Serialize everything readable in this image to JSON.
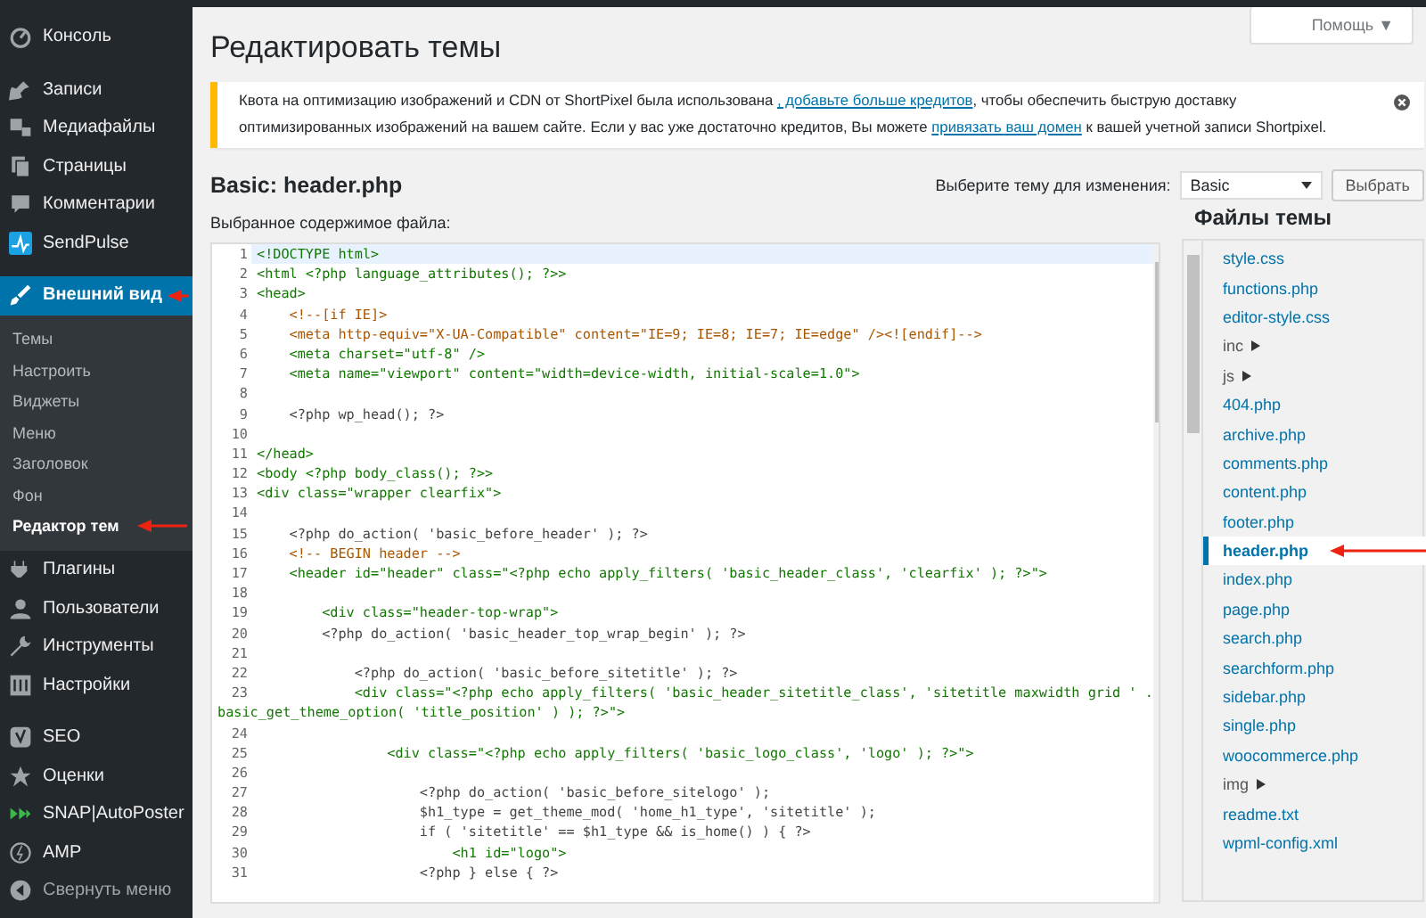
{
  "sidebar": {
    "items": [
      {
        "label": "Консоль",
        "selected": false,
        "marked": false
      },
      {
        "label": "Записи",
        "selected": false,
        "marked": false
      },
      {
        "label": "Медиафайлы",
        "selected": false,
        "marked": false
      },
      {
        "label": "Страницы",
        "selected": false,
        "marked": false
      },
      {
        "label": "Комментарии",
        "selected": false,
        "marked": false
      },
      {
        "label": "SendPulse",
        "selected": false,
        "marked": false
      },
      {
        "label": "Внешний вид",
        "selected": true,
        "marked": true,
        "children": [
          {
            "label": "Темы",
            "selected": false,
            "marked": false
          },
          {
            "label": "Настроить",
            "selected": false,
            "marked": false
          },
          {
            "label": "Виджеты",
            "selected": false,
            "marked": false
          },
          {
            "label": "Меню",
            "selected": false,
            "marked": false
          },
          {
            "label": "Заголовок",
            "selected": false,
            "marked": false
          },
          {
            "label": "Фон",
            "selected": false,
            "marked": false
          },
          {
            "label": "Редактор тем",
            "selected": true,
            "marked": true
          }
        ]
      },
      {
        "label": "Плагины",
        "selected": false,
        "marked": false
      },
      {
        "label": "Пользователи",
        "selected": false,
        "marked": false
      },
      {
        "label": "Инструменты",
        "selected": false,
        "marked": false
      },
      {
        "label": "Настройки",
        "selected": false,
        "marked": false
      },
      {
        "label": "SEO",
        "selected": false,
        "marked": false
      },
      {
        "label": "Оценки",
        "selected": false,
        "marked": false
      },
      {
        "label": "SNAP|AutoPoster",
        "selected": false,
        "marked": false
      },
      {
        "label": "AMP",
        "selected": false,
        "marked": false
      },
      {
        "label": "Свернуть меню",
        "selected": false,
        "marked": false
      }
    ]
  },
  "help_button": {
    "label": "Помощь ▼"
  },
  "page_title": "Редактировать темы",
  "notice": {
    "text_before": "Квота на оптимизацию изображений и CDN от ShortPixel была использована ",
    "link1": ", добавьте больше кредитов",
    "text_middle": ", чтобы обеспечить быструю доставку оптимизированных изображений на вашем сайте. Если у вас уже достаточно кредитов, Вы можете ",
    "link2": "привязать ваш домен",
    "text_after": " к вашей учетной записи Shortpixel."
  },
  "file_heading": "Basic: header.php",
  "theme_select": {
    "label": "Выберите тему для изменения:",
    "value": "Basic",
    "button": "Выбрать"
  },
  "content_label": "Выбранное содержимое файла:",
  "editor": {
    "lines": [
      {
        "number": "1",
        "kind": "markup",
        "text": "<!DOCTYPE html>",
        "selected": true
      },
      {
        "number": "2",
        "kind": "markup",
        "text": "<html <?php language_attributes(); ?>>",
        "selected": false
      },
      {
        "number": "3",
        "kind": "markup",
        "text": "<head>",
        "selected": false
      },
      {
        "number": "4",
        "kind": "comment",
        "text": "    <!--[if IE]>",
        "selected": false
      },
      {
        "number": "5",
        "kind": "comment",
        "text": "    <meta http-equiv=\"X-UA-Compatible\" content=\"IE=9; IE=8; IE=7; IE=edge\" /><![endif]-->",
        "selected": false
      },
      {
        "number": "6",
        "kind": "markup",
        "text": "    <meta charset=\"utf-8\" />",
        "selected": false
      },
      {
        "number": "7",
        "kind": "markup",
        "text": "    <meta name=\"viewport\" content=\"width=device-width, initial-scale=1.0\">",
        "selected": false
      },
      {
        "number": "8",
        "kind": "markup",
        "selected": false
      },
      {
        "number": "9",
        "kind": "php",
        "text": "    <?php wp_head(); ?>",
        "selected": false
      },
      {
        "number": "10",
        "kind": "markup",
        "selected": false
      },
      {
        "number": "11",
        "kind": "markup",
        "text": "</head>",
        "selected": false
      },
      {
        "number": "12",
        "kind": "markup",
        "text": "<body <?php body_class(); ?>>",
        "selected": false
      },
      {
        "number": "13",
        "kind": "markup",
        "text": "<div class=\"wrapper clearfix\">",
        "selected": false
      },
      {
        "number": "14",
        "kind": "markup",
        "selected": false
      },
      {
        "number": "15",
        "kind": "php",
        "text": "    <?php do_action( 'basic_before_header' ); ?>",
        "selected": false
      },
      {
        "number": "16",
        "kind": "comment",
        "text": "    <!-- BEGIN header -->",
        "selected": false
      },
      {
        "number": "17",
        "kind": "markup",
        "text": "    <header id=\"header\" class=\"<?php echo apply_filters( 'basic_header_class', 'clearfix' ); ?>\">",
        "selected": false
      },
      {
        "number": "18",
        "kind": "markup",
        "selected": false
      },
      {
        "number": "19",
        "kind": "markup",
        "text": "        <div class=\"header-top-wrap\">",
        "selected": false
      },
      {
        "number": "20",
        "kind": "php",
        "text": "        <?php do_action( 'basic_header_top_wrap_begin' ); ?>",
        "selected": false
      },
      {
        "number": "21",
        "kind": "markup",
        "selected": false
      },
      {
        "number": "22",
        "kind": "php",
        "text": "            <?php do_action( 'basic_before_sitetitle' ); ?>",
        "selected": false
      },
      {
        "number": "23",
        "kind": "markup",
        "text": "            <div class=\"<?php echo apply_filters( 'basic_header_sitetitle_class', 'sitetitle maxwidth grid ' .",
        "wrapped": "basic_get_theme_option( 'title_position' ) ); ?>\">",
        "selected": false
      },
      {
        "number": "24",
        "kind": "markup",
        "selected": false
      },
      {
        "number": "25",
        "kind": "markup",
        "text": "                <div class=\"<?php echo apply_filters( 'basic_logo_class', 'logo' ); ?>\">",
        "selected": false
      },
      {
        "number": "26",
        "kind": "markup",
        "selected": false
      },
      {
        "number": "27",
        "kind": "php",
        "text": "                    <?php do_action( 'basic_before_sitelogo' );",
        "selected": false
      },
      {
        "number": "28",
        "kind": "php",
        "text": "                    $h1_type = get_theme_mod( 'home_h1_type', 'sitetitle' );",
        "selected": false
      },
      {
        "number": "29",
        "kind": "php",
        "text": "                    if ( 'sitetitle' == $h1_type && is_home() ) { ?>",
        "selected": false
      },
      {
        "number": "30",
        "kind": "markup",
        "text": "                        <h1 id=\"logo\">",
        "selected": false
      },
      {
        "number": "31",
        "kind": "php",
        "text": "                    <?php } else { ?>",
        "selected": false
      }
    ]
  },
  "files": {
    "title": "Файлы темы",
    "items": [
      {
        "label": "style.css",
        "kind": "file",
        "selected": false,
        "marked": false
      },
      {
        "label": "functions.php",
        "kind": "file",
        "selected": false,
        "marked": false
      },
      {
        "label": "editor-style.css",
        "kind": "file",
        "selected": false,
        "marked": false
      },
      {
        "label": "inc",
        "kind": "folder",
        "selected": false,
        "marked": false
      },
      {
        "label": "js",
        "kind": "folder",
        "selected": false,
        "marked": false
      },
      {
        "label": "404.php",
        "kind": "file",
        "selected": false,
        "marked": false
      },
      {
        "label": "archive.php",
        "kind": "file",
        "selected": false,
        "marked": false
      },
      {
        "label": "comments.php",
        "kind": "file",
        "selected": false,
        "marked": false
      },
      {
        "label": "content.php",
        "kind": "file",
        "selected": false,
        "marked": false
      },
      {
        "label": "footer.php",
        "kind": "file",
        "selected": false,
        "marked": false
      },
      {
        "label": "header.php",
        "kind": "file",
        "selected": true,
        "marked": true
      },
      {
        "label": "index.php",
        "kind": "file",
        "selected": false,
        "marked": false
      },
      {
        "label": "page.php",
        "kind": "file",
        "selected": false,
        "marked": false
      },
      {
        "label": "search.php",
        "kind": "file",
        "selected": false,
        "marked": false
      },
      {
        "label": "searchform.php",
        "kind": "file",
        "selected": false,
        "marked": false
      },
      {
        "label": "sidebar.php",
        "kind": "file",
        "selected": false,
        "marked": false
      },
      {
        "label": "single.php",
        "kind": "file",
        "selected": false,
        "marked": false
      },
      {
        "label": "woocommerce.php",
        "kind": "file",
        "selected": false,
        "marked": false
      },
      {
        "label": "img",
        "kind": "folder",
        "selected": false,
        "marked": false
      },
      {
        "label": "readme.txt",
        "kind": "file",
        "selected": false,
        "marked": false
      },
      {
        "label": "wpml-config.xml",
        "kind": "file",
        "selected": false,
        "marked": false
      }
    ]
  }
}
